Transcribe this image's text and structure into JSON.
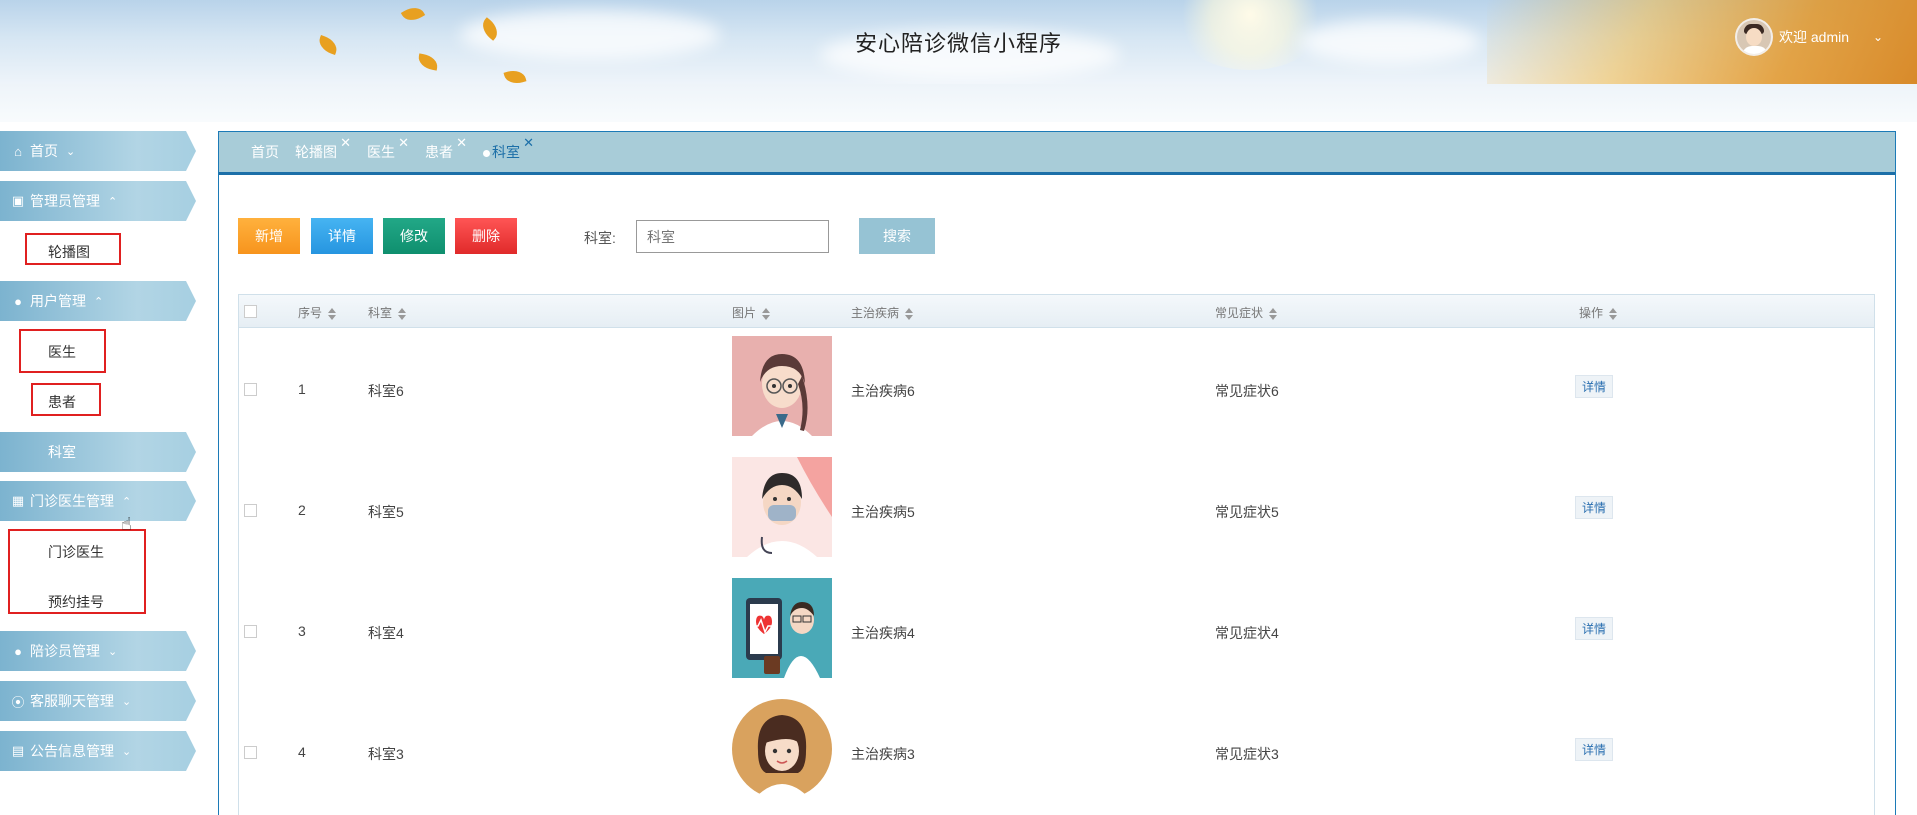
{
  "header": {
    "title": "安心陪诊微信小程序",
    "welcome": "欢迎 admin",
    "dropdown_icon": "chevron-down-icon"
  },
  "sidebar": {
    "items": [
      {
        "label": "首页",
        "icon": "home-icon",
        "expanded": false
      },
      {
        "label": "管理员管理",
        "icon": "gift-icon",
        "expanded": true
      },
      {
        "label": "用户管理",
        "icon": "user-icon",
        "expanded": true
      },
      {
        "label": "科室",
        "icon": "",
        "active": true
      },
      {
        "label": "门诊医生管理",
        "icon": "building-icon",
        "expanded": true
      },
      {
        "label": "陪诊员管理",
        "icon": "user-icon",
        "expanded": false
      },
      {
        "label": "客服聊天管理",
        "icon": "compass-icon",
        "expanded": false
      },
      {
        "label": "公告信息管理",
        "icon": "chart-icon",
        "expanded": false
      }
    ],
    "subitems": {
      "banner": "轮播图",
      "doctor": "医生",
      "patient": "患者",
      "clinic_doctor": "门诊医生",
      "appointment": "预约挂号"
    }
  },
  "tabs": [
    {
      "label": "首页",
      "closable": false
    },
    {
      "label": "轮播图",
      "closable": true
    },
    {
      "label": "医生",
      "closable": true
    },
    {
      "label": "患者",
      "closable": true
    },
    {
      "label": "科室",
      "closable": true,
      "active": true
    }
  ],
  "toolbar": {
    "add": "新增",
    "detail": "详情",
    "edit": "修改",
    "delete": "删除",
    "search_label": "科室:",
    "search_placeholder": "科室",
    "search_button": "搜索"
  },
  "table": {
    "columns": [
      "序号",
      "科室",
      "图片",
      "主治疾病",
      "常见症状",
      "操作"
    ],
    "rows": [
      {
        "no": "1",
        "dept": "科室6",
        "disease": "主治疾病6",
        "symptom": "常见症状6",
        "action": "详情"
      },
      {
        "no": "2",
        "dept": "科室5",
        "disease": "主治疾病5",
        "symptom": "常见症状5",
        "action": "详情"
      },
      {
        "no": "3",
        "dept": "科室4",
        "disease": "主治疾病4",
        "symptom": "常见症状4",
        "action": "详情"
      },
      {
        "no": "4",
        "dept": "科室3",
        "disease": "主治疾病3",
        "symptom": "常见症状3",
        "action": "详情"
      }
    ]
  },
  "colors": {
    "accent": "#1c6fa8",
    "menu": "#8fc3da",
    "highlight_box": "#e02020"
  }
}
